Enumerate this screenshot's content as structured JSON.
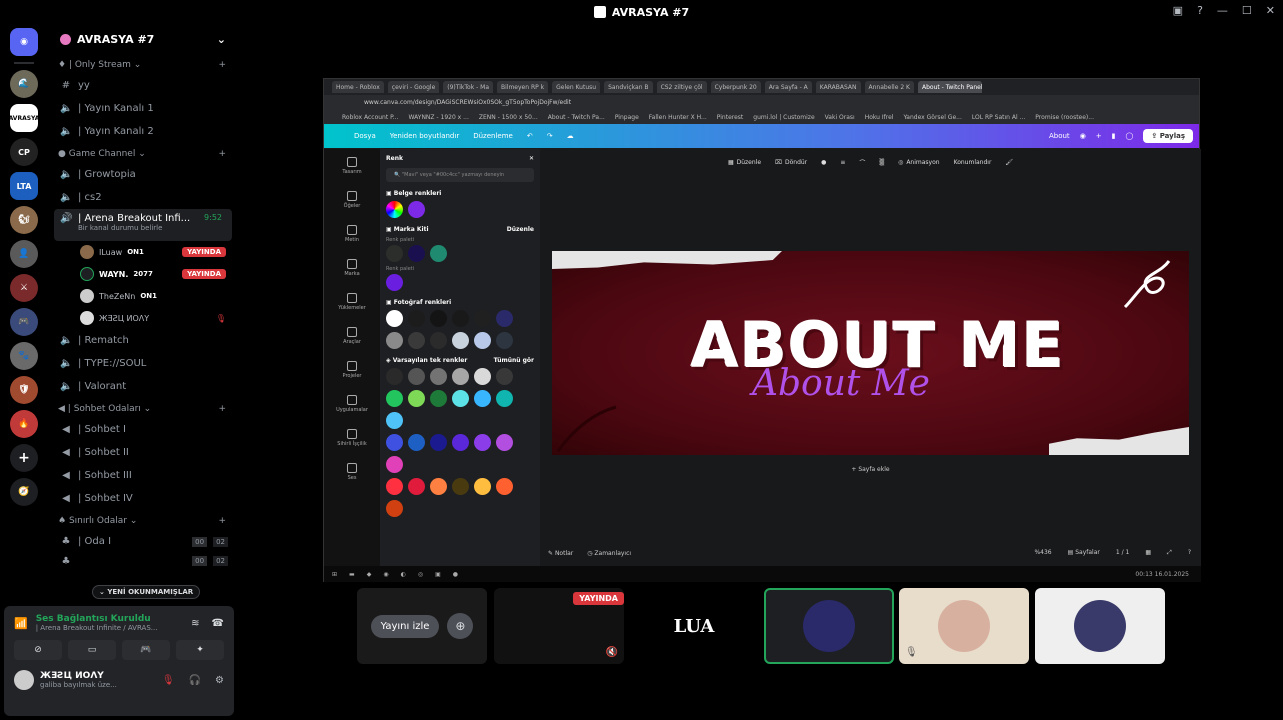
{
  "window": {
    "title": "AVRASYA #7",
    "controls": [
      "—",
      "☐",
      "✕"
    ]
  },
  "rail": {
    "servers": [
      "🌊",
      "AVRASYA",
      "CP",
      "LTA",
      "🐿",
      "👤",
      "⚔",
      "🎮",
      "🐾",
      "🛡",
      "🔥",
      "+",
      "🧭"
    ]
  },
  "guild": {
    "name": "AVRASYA #7"
  },
  "channels": {
    "cat_only_stream": "| Only Stream",
    "yy": "yy",
    "yayin_kanali_1": "| Yayın Kanalı 1",
    "yayin_kanali_2": "| Yayın Kanalı 2",
    "cat_game": "Game Channel",
    "growtopia": "| Growtopia",
    "cs2": "| cs2",
    "arena": "| Arena Breakout Infi...",
    "arena_sub": "Bir kanal durumu belirle",
    "arena_time": "9:52",
    "rematch": "| Rematch",
    "type_soul": "| TYPE://SOUL",
    "valorant": "| Valorant",
    "cat_sohbet": "| Sohbet Odaları",
    "sohbet_1": "| Sohbet I",
    "sohbet_2": "| Sohbet II",
    "sohbet_3": "| Sohbet III",
    "sohbet_4": "| Sohbet IV",
    "cat_sinirli": "Sınırlı Odalar",
    "oda_1": "| Oda I",
    "oda_1_count": "00",
    "oda_1_limit": "02",
    "oda_2_count": "00",
    "oda_2_limit": "02",
    "unread": "YENİ OKUNMAMIŞLAR"
  },
  "members": [
    {
      "name": "ILuaw",
      "tag": "ON1",
      "live": "YAYINDA"
    },
    {
      "name": "WAYN.",
      "tag": "2077",
      "live": "YAYINDA"
    },
    {
      "name": "TheZeNn",
      "tag": "ON1",
      "live": ""
    },
    {
      "name": "ЖƎƧЦ ИОΛΥ",
      "tag": "",
      "live": ""
    }
  ],
  "voice": {
    "status": "Ses Bağlantısı Kuruldu",
    "channel": "| Arena Breakout Infinite / AVRAS...",
    "user_name": "ЖƎƧЦ ИОΛΥ",
    "user_status": "galiba bayılmak üze..."
  },
  "browser": {
    "tabs": [
      "Home - Roblox",
      "çeviri - Google",
      "(9)TikTok - Ma",
      "Bilmeyen RP k",
      "Gelen Kutusu",
      "Sandviçkan B",
      "CS2 ziltiye çöl",
      "Cyberpunk 20",
      "Ara Sayfa - A",
      "KARABASAN",
      "Annabelle 2 K",
      "About - Twitch Panel"
    ],
    "url": "www.canva.com/design/DAGiSCREWsiOx0SOk_gT5opToPojDojFw/edit",
    "bookmarks": [
      "Roblox Account P...",
      "WAYNNZ - 1920 x ...",
      "ZENN - 1500 x 50...",
      "About - Twitch Pa...",
      "Pinpage",
      "Fallen Hunter X H...",
      "Pinterest",
      "gumi.lol | Customize",
      "Vaki Orası",
      "Hoku Ifrel",
      "Yandex Görsel Ge...",
      "LOL RP Satın Al ...",
      "Promise (roostee)..."
    ]
  },
  "canva": {
    "menu": [
      "Dosya",
      "Yeniden boyutlandır",
      "Düzenleme"
    ],
    "about": "About",
    "share": "Paylaş",
    "side": [
      "Tasarım",
      "Öğeler",
      "Metin",
      "Marka",
      "Yüklemeler",
      "Araçlar",
      "Projeler",
      "Uygulamalar",
      "Sihirli İşçilik",
      "Ses"
    ],
    "panel_title": "Renk",
    "search_placeholder": "\"Mavi\" veya \"#00c4cc\" yazmayı deneyin",
    "belge": "Belge renkleri",
    "marka": "Marka Kiti",
    "duzenle": "Düzenle",
    "renk_paleti": "Renk paleti",
    "renk_paleti2": "Renk paleti",
    "foto": "Fotoğraf renkleri",
    "varsayilan": "Varsayılan tek renkler",
    "tumunu": "Tümünü gör",
    "toolbar": [
      "Düzenle",
      "Döndür",
      "Animasyon",
      "Konumlandır"
    ],
    "banner_big": "ABOUT ME",
    "banner_script": "About Me",
    "add_page": "+ Sayfa ekle",
    "notes": "Notlar",
    "timer": "Zamanlayıcı",
    "zoom": "%436",
    "pages": "Sayfalar",
    "page_count": "1 / 1",
    "clock": "00:13",
    "date": "16.01.2025"
  },
  "colors": {
    "belge": [
      "#7d2ae8"
    ],
    "marka1": [
      "#2b2e2a",
      "#1a1050",
      "#1f8a70"
    ],
    "marka2": [
      "#6a1fe0"
    ],
    "foto1": [
      "#ffffff",
      "#1c1c1c",
      "#141414",
      "#191919",
      "#202020",
      "#2a2a6a"
    ],
    "foto2": [
      "#8a8a8a",
      "#3a3a3a",
      "#2b2b2b",
      "#c8d2dc",
      "#b8c8e8",
      "#2c3540"
    ],
    "default1": [
      "#2a2a2a",
      "#555555",
      "#737373",
      "#a6a6a6",
      "#d9d9d9",
      "#383838"
    ],
    "default2": [
      "#22c55e",
      "#7ed957",
      "#1e7a38",
      "#5ce1e6",
      "#38b6ff",
      "#0fb5ae",
      "#4fc3f7"
    ],
    "default3": [
      "#3f51e0",
      "#1e5fc4",
      "#1b1b8f",
      "#5a27d9",
      "#8c3dea",
      "#b24ee0",
      "#e040b8"
    ],
    "default4": [
      "#ff3040",
      "#e01b3c",
      "#ff8040",
      "#4a3a10",
      "#ffbd40",
      "#ff6030",
      "#d04010"
    ]
  },
  "tiles": {
    "watch": "Yayını izle",
    "live": "YAYINDA",
    "lua": "LUA"
  }
}
